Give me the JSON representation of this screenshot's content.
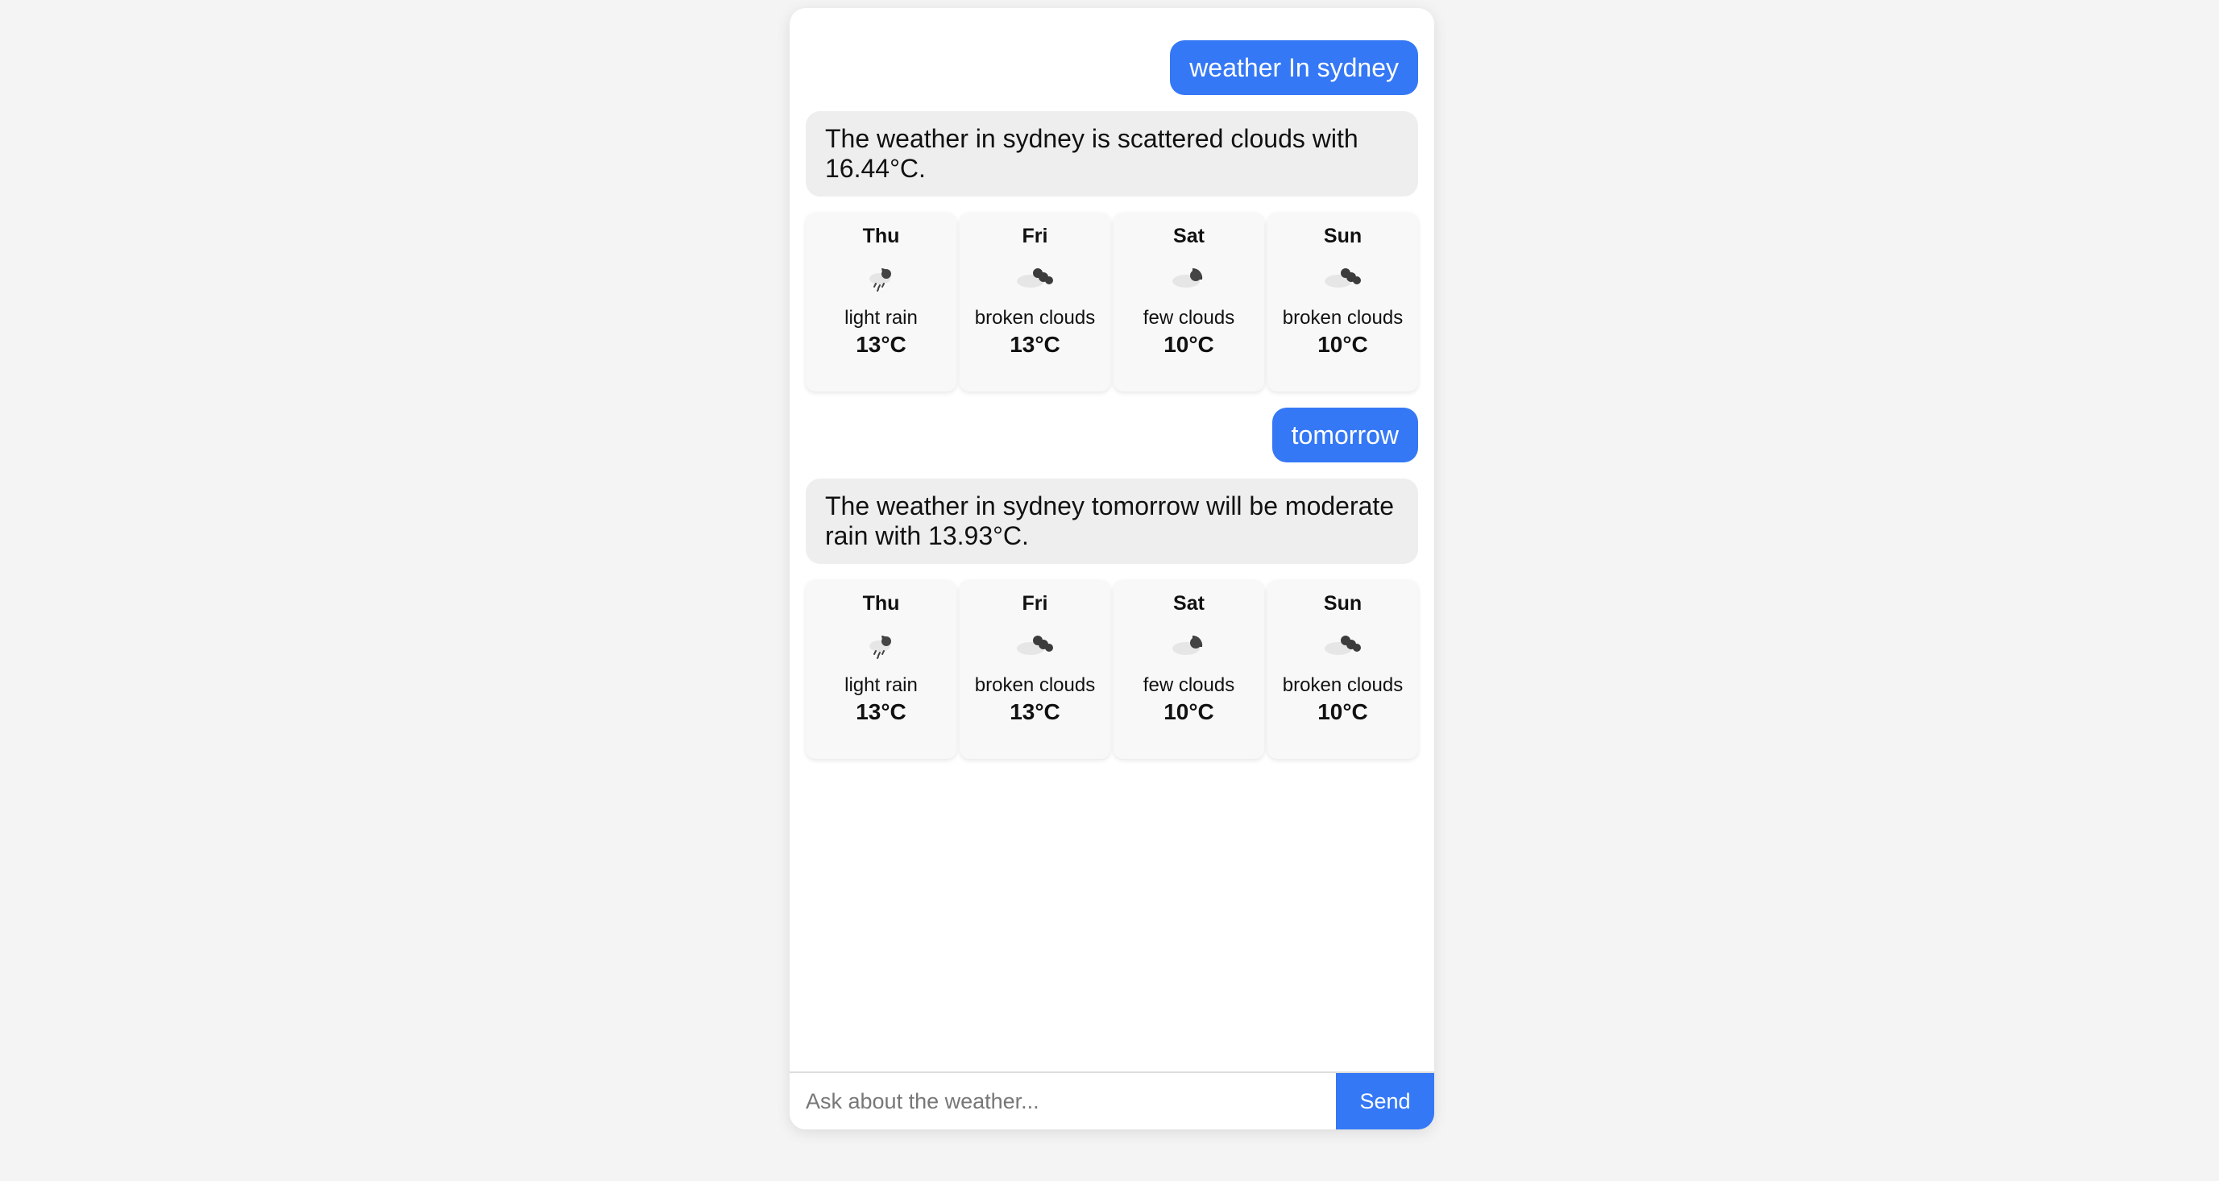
{
  "conversation": [
    {
      "user": "weather In sydney",
      "bot": "The weather in sydney is scattered clouds with 16.44°C.",
      "forecast": [
        {
          "day": "Thu",
          "desc": "light rain",
          "temp": "13°C",
          "icon": "light-rain-icon"
        },
        {
          "day": "Fri",
          "desc": "broken clouds",
          "temp": "13°C",
          "icon": "broken-clouds-icon"
        },
        {
          "day": "Sat",
          "desc": "few clouds",
          "temp": "10°C",
          "icon": "few-clouds-icon"
        },
        {
          "day": "Sun",
          "desc": "broken clouds",
          "temp": "10°C",
          "icon": "broken-clouds-icon"
        }
      ]
    },
    {
      "user": "tomorrow",
      "bot": "The weather in sydney tomorrow will be moderate rain with 13.93°C.",
      "forecast": [
        {
          "day": "Thu",
          "desc": "light rain",
          "temp": "13°C",
          "icon": "light-rain-icon"
        },
        {
          "day": "Fri",
          "desc": "broken clouds",
          "temp": "13°C",
          "icon": "broken-clouds-icon"
        },
        {
          "day": "Sat",
          "desc": "few clouds",
          "temp": "10°C",
          "icon": "few-clouds-icon"
        },
        {
          "day": "Sun",
          "desc": "broken clouds",
          "temp": "10°C",
          "icon": "broken-clouds-icon"
        }
      ]
    }
  ],
  "input": {
    "placeholder": "Ask about the weather...",
    "value": ""
  },
  "send_label": "Send",
  "colors": {
    "accent": "#3478f6",
    "bot_bubble": "#eeeeee",
    "card": "#f8f8f8",
    "page_bg": "#f4f4f4"
  }
}
